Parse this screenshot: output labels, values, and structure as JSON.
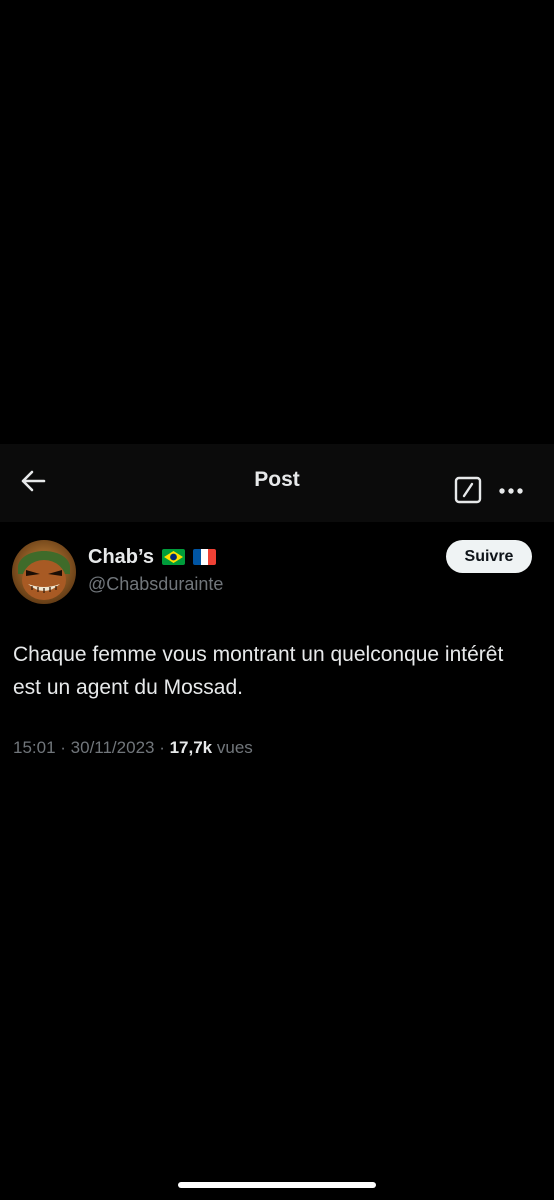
{
  "header": {
    "title": "Post"
  },
  "post": {
    "author": {
      "display_name": "Chab’s",
      "flags": [
        "brazil-flag",
        "france-flag"
      ],
      "handle": "@Chabsdurainte"
    },
    "follow_label": "Suivre",
    "text": "Chaque femme vous montrant un quelconque intérêt est un agent du Mossad.",
    "time": "15:01",
    "sep1": " · ",
    "date": "30/11/2023",
    "sep2": " · ",
    "views_count": "17,7k",
    "views_label": " vues"
  },
  "icons": {
    "back": "arrow-left-icon",
    "edit": "compose-slash-icon",
    "more": "more-dots-icon"
  },
  "colors": {
    "background": "#000000",
    "header_bg": "#0b0b0b",
    "primary_text": "#e7e9ea",
    "secondary_text": "#71767b",
    "follow_button_bg": "#eff3f4"
  }
}
